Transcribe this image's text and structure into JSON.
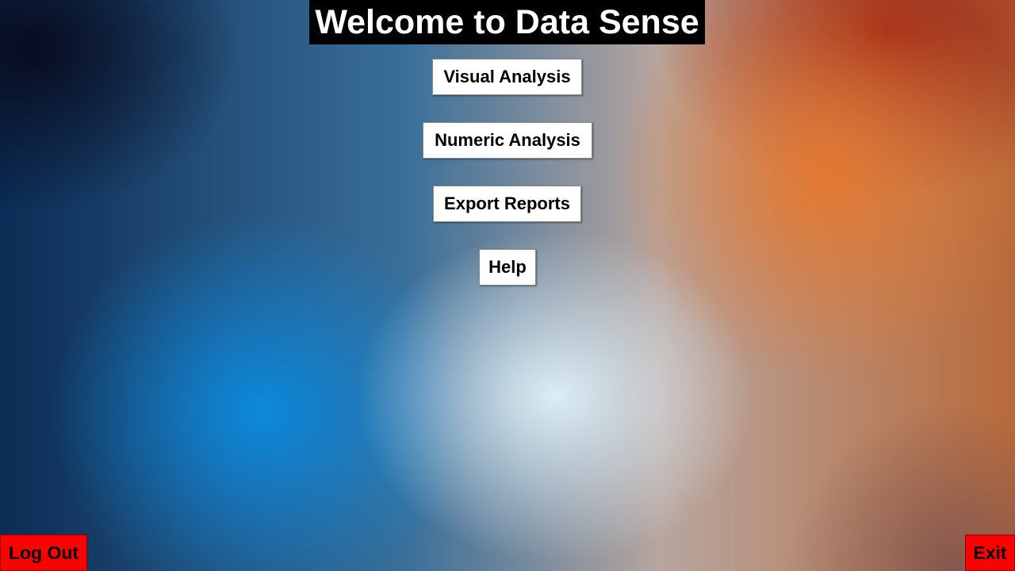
{
  "header": {
    "title": "Welcome to Data Sense"
  },
  "menu": {
    "visual_analysis_label": "Visual Analysis",
    "numeric_analysis_label": "Numeric Analysis",
    "export_reports_label": "Export Reports",
    "help_label": "Help"
  },
  "footer": {
    "logout_label": "Log Out",
    "exit_label": "Exit"
  },
  "colors": {
    "title_background": "#000000",
    "title_text": "#ffffff",
    "menu_button_background": "#ffffff",
    "corner_button_background": "#ff0000"
  }
}
